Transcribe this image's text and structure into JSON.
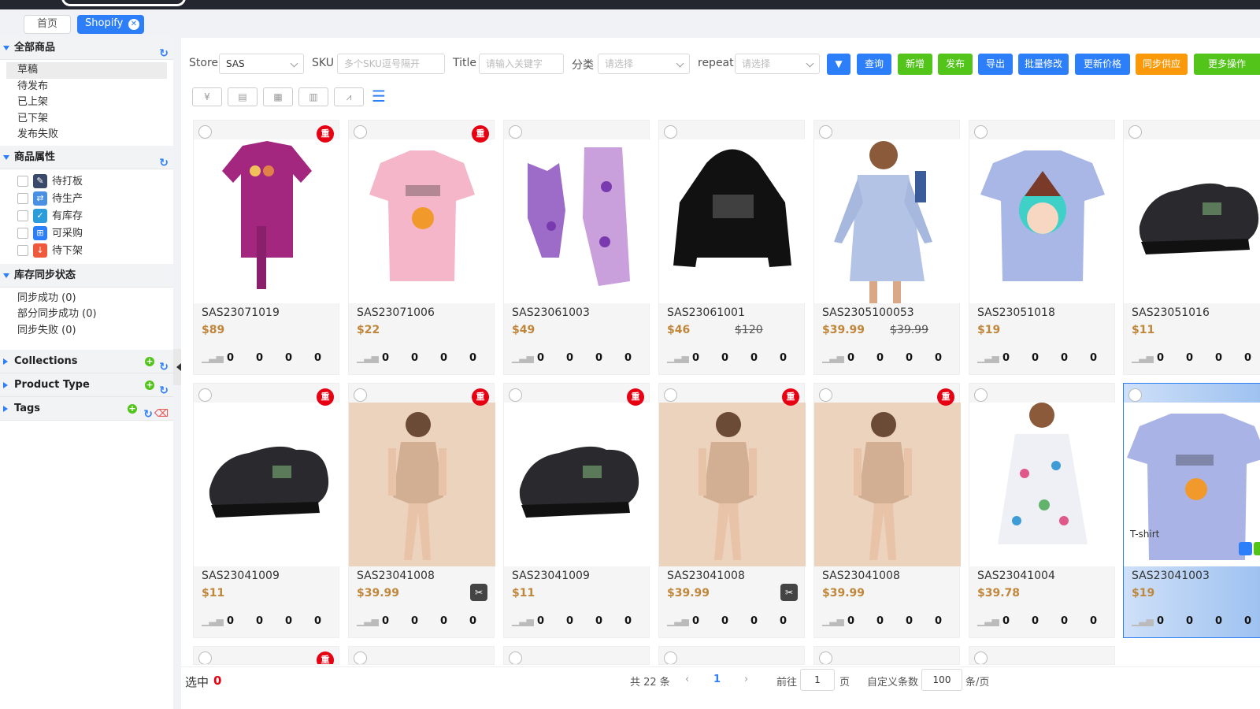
{
  "tabs": {
    "home": "首页",
    "shopify": "Shopify"
  },
  "sidebar": {
    "all_goods": {
      "title": "全部商品",
      "items": [
        "草稿",
        "待发布",
        "已上架",
        "已下架",
        "发布失败"
      ]
    },
    "attributes": {
      "title": "商品属性",
      "items": [
        "待打板",
        "待生产",
        "有库存",
        "可采购",
        "待下架"
      ]
    },
    "stock_sync": {
      "title": "库存同步状态",
      "items": [
        "同步成功 (0)",
        "部分同步成功 (0)",
        "同步失败 (0)"
      ]
    },
    "collections": "Collections",
    "product_type": "Product Type",
    "tags": "Tags"
  },
  "filters": {
    "store_label": "Store",
    "store_value": "SAS",
    "sku_label": "SKU",
    "sku_placeholder": "多个SKU逗号隔开",
    "title_label": "Title",
    "title_placeholder": "请输入关键字",
    "category_label": "分类",
    "category_placeholder": "请选择",
    "repeat_label": "repeat",
    "repeat_placeholder": "请选择"
  },
  "buttons": {
    "query": "查询",
    "add": "新增",
    "publish": "发布",
    "export": "导出",
    "batch_edit": "批量修改",
    "update_price": "更新价格",
    "sync_supply": "同步供应",
    "more": "更多操作"
  },
  "dup_badge": "重",
  "cards_row1": [
    {
      "sku": "SAS23071019",
      "price": "$89",
      "old": "",
      "dup": true
    },
    {
      "sku": "SAS23071006",
      "price": "$22",
      "old": "",
      "dup": true
    },
    {
      "sku": "SAS23061003",
      "price": "$49",
      "old": "",
      "dup": false
    },
    {
      "sku": "SAS23061001",
      "price": "$46",
      "old": "$120",
      "dup": false
    },
    {
      "sku": "SAS2305100053",
      "price": "$39.99",
      "old": "$39.99",
      "dup": false
    },
    {
      "sku": "SAS23051018",
      "price": "$19",
      "old": "",
      "dup": false
    },
    {
      "sku": "SAS23051016",
      "price": "$11",
      "old": "",
      "dup": false
    }
  ],
  "cards_row2": [
    {
      "sku": "SAS23041009",
      "price": "$11",
      "dup": true
    },
    {
      "sku": "SAS23041008",
      "price": "$39.99",
      "dup": true
    },
    {
      "sku": "SAS23041009",
      "price": "$11",
      "dup": true
    },
    {
      "sku": "SAS23041008",
      "price": "$39.99",
      "dup": true
    },
    {
      "sku": "SAS23041008",
      "price": "$39.99",
      "dup": true
    },
    {
      "sku": "SAS23041004",
      "price": "$39.78",
      "dup": false
    },
    {
      "sku": "SAS23041003",
      "price": "$19",
      "dup": false,
      "type": "T-shirt"
    }
  ],
  "stat_values": [
    "0",
    "0",
    "0",
    "0"
  ],
  "footer": {
    "selected_label": "选中",
    "selected_count": "0",
    "total": "共 22 条",
    "current_page": "1",
    "goto_label": "前往",
    "goto_value": "1",
    "page_unit": "页",
    "custom_label": "自定义条数",
    "page_size": "100",
    "per_page": "条/页"
  }
}
